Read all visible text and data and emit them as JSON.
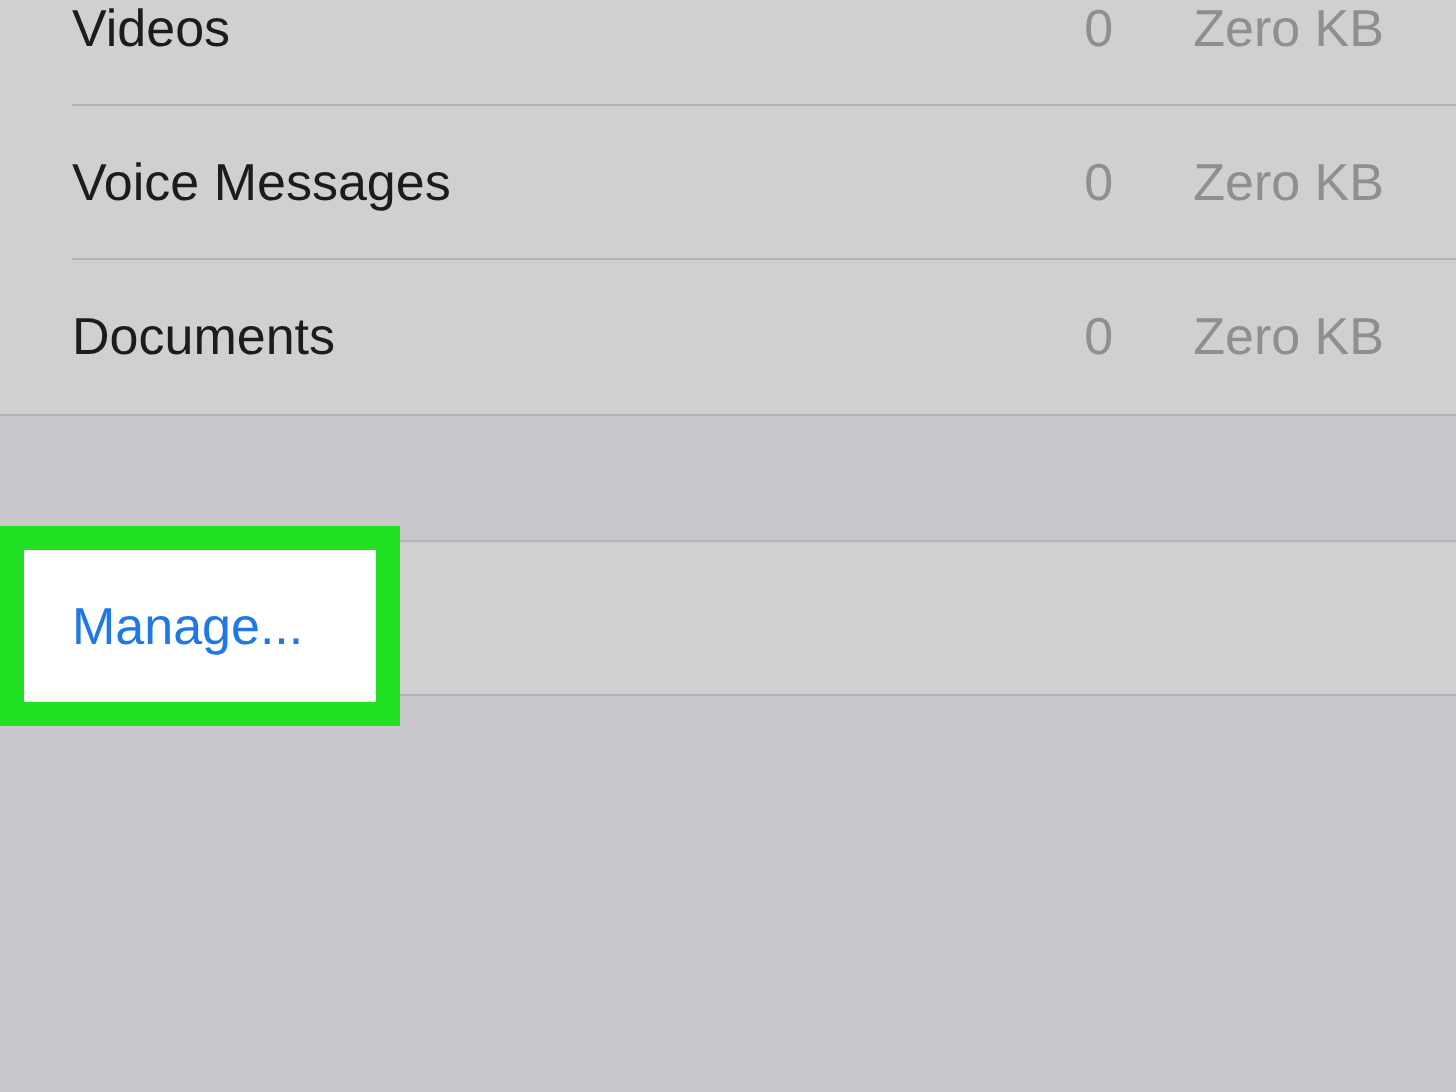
{
  "storage_rows": [
    {
      "label": "Videos",
      "count": "0",
      "size": "Zero KB"
    },
    {
      "label": "Voice Messages",
      "count": "0",
      "size": "Zero KB"
    },
    {
      "label": "Documents",
      "count": "0",
      "size": "Zero KB"
    }
  ],
  "manage": {
    "label": "Manage...",
    "highlighted": true
  }
}
